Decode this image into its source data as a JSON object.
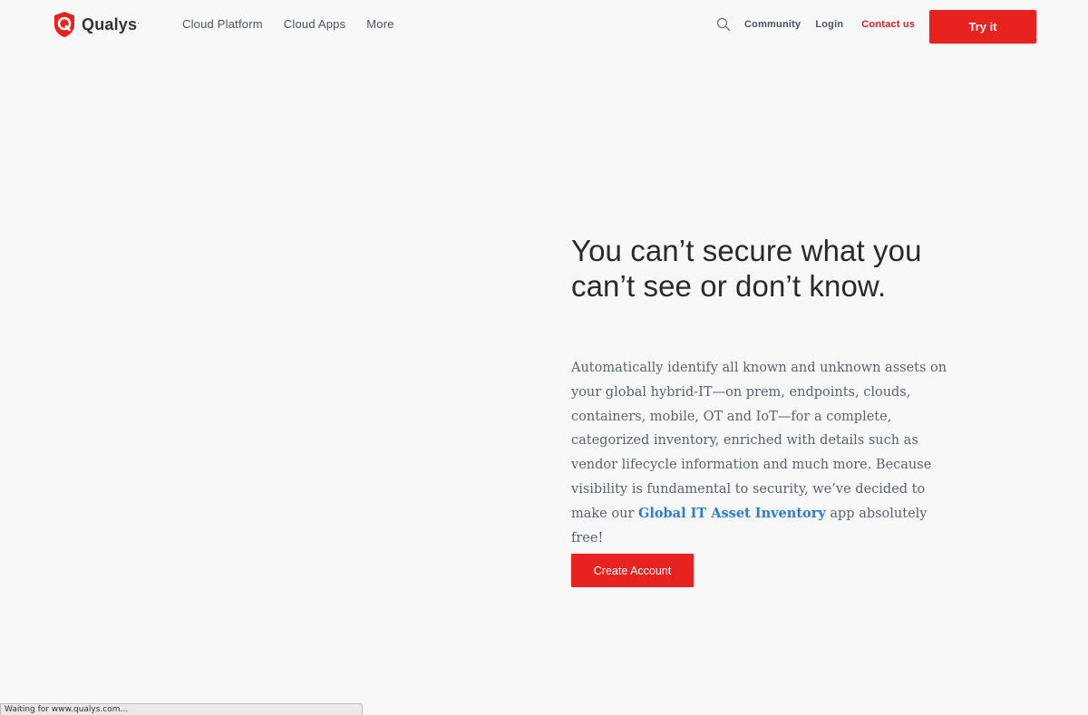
{
  "brand": {
    "name": "Qualys",
    "mark": "."
  },
  "nav": {
    "primary": [
      {
        "label": "Cloud Platform"
      },
      {
        "label": "Cloud Apps"
      },
      {
        "label": "More"
      }
    ],
    "search_icon": "search-icon",
    "community": "Community",
    "login": "Login",
    "contact": "Contact us",
    "try_it": "Try it"
  },
  "hero": {
    "title": "You can’t secure what you can’t see or don’t know.",
    "description_before": "Automatically identify all known and unknown assets on your global hybrid-IT—on prem, endpoints, clouds, containers, mobile, OT and IoT—for a complete, categorized inventory, enriched with details such as vendor lifecycle information and much more. Because visibility is fundamental to security, we’ve decided to make our ",
    "description_link": "Global IT Asset Inventory",
    "description_after": " app absolutely free!",
    "cta": "Create Account"
  },
  "status_bar": {
    "text": "Waiting for www.qualys.com..."
  },
  "colors": {
    "accent": "#e8221f",
    "link": "#2f7bd1",
    "background": "#f8f8f8",
    "nav_text": "#4a5260"
  }
}
